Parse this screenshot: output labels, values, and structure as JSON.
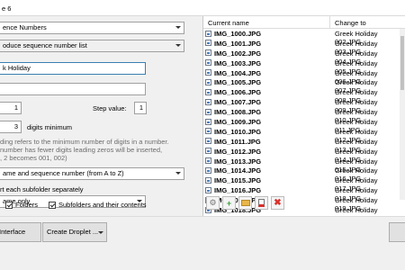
{
  "window": {
    "title": "e 6"
  },
  "settings": {
    "method_combo": "ence Numbers",
    "action_combo": "oduce sequence number list",
    "name_input": "k Holiday",
    "second_input": "",
    "start_value": "1",
    "step_label": "Step value:",
    "step_value": "1",
    "digits_value": "3",
    "digits_label": "digits minimum",
    "description_lines": [
      "ding refers to the minimum number of digits in a number.",
      "number has fewer digits leading zeros will be inserted,",
      ", 2 becomes 001, 002)"
    ],
    "sort_combo": "ame and sequence number (from A to Z)",
    "subfolder_label": "rt each subfolder separately",
    "apply_combo": "ame only",
    "folders_label": "Folders",
    "subfolders_label": "Subfolders and their contents"
  },
  "table": {
    "headers": {
      "current": "Current name",
      "change": "Change to"
    },
    "rows": [
      {
        "current": "IMG_1000.JPG",
        "change": "Greek Holiday 002.JPG"
      },
      {
        "current": "IMG_1001.JPG",
        "change": "Greek Holiday 003.JPG"
      },
      {
        "current": "IMG_1002.JPG",
        "change": "Greek Holiday 004.JPG"
      },
      {
        "current": "IMG_1003.JPG",
        "change": "Greek Holiday 005.JPG"
      },
      {
        "current": "IMG_1004.JPG",
        "change": "Greek Holiday 006.JPG"
      },
      {
        "current": "IMG_1005.JPG",
        "change": "Greek Holiday 007.JPG"
      },
      {
        "current": "IMG_1006.JPG",
        "change": "Greek Holiday 008.JPG"
      },
      {
        "current": "IMG_1007.JPG",
        "change": "Greek Holiday 009.JPG"
      },
      {
        "current": "IMG_1008.JPG",
        "change": "Greek Holiday 010.JPG"
      },
      {
        "current": "IMG_1009.JPG",
        "change": "Greek Holiday 011.JPG"
      },
      {
        "current": "IMG_1010.JPG",
        "change": "Greek Holiday 012.JPG"
      },
      {
        "current": "IMG_1011.JPG",
        "change": "Greek Holiday 013.JPG"
      },
      {
        "current": "IMG_1012.JPG",
        "change": "Greek Holiday 014.JPG"
      },
      {
        "current": "IMG_1013.JPG",
        "change": "Greek Holiday 015.JPG"
      },
      {
        "current": "IMG_1014.JPG",
        "change": "Greek Holiday 016.JPG"
      },
      {
        "current": "IMG_1015.JPG",
        "change": "Greek Holiday 017.JPG"
      },
      {
        "current": "IMG_1016.JPG",
        "change": "Greek Holiday 018.JPG"
      },
      {
        "current": "IMG_1017.JPG",
        "change": "Greek Holiday 019.JPG"
      },
      {
        "current": "IMG_1018.JPG",
        "change": "Greek Holiday 020.JPG"
      }
    ]
  },
  "toolbar": {
    "icons": [
      "settings-icon",
      "add-file-icon",
      "add-folder-icon",
      "remove-file-icon",
      "clear-list-icon"
    ]
  },
  "footer": {
    "interface_label": "Interface",
    "droplet_label": "Create Droplet ..."
  },
  "colors": {
    "accent_red": "#d9302c",
    "accent_blue": "#3c7fb1"
  }
}
